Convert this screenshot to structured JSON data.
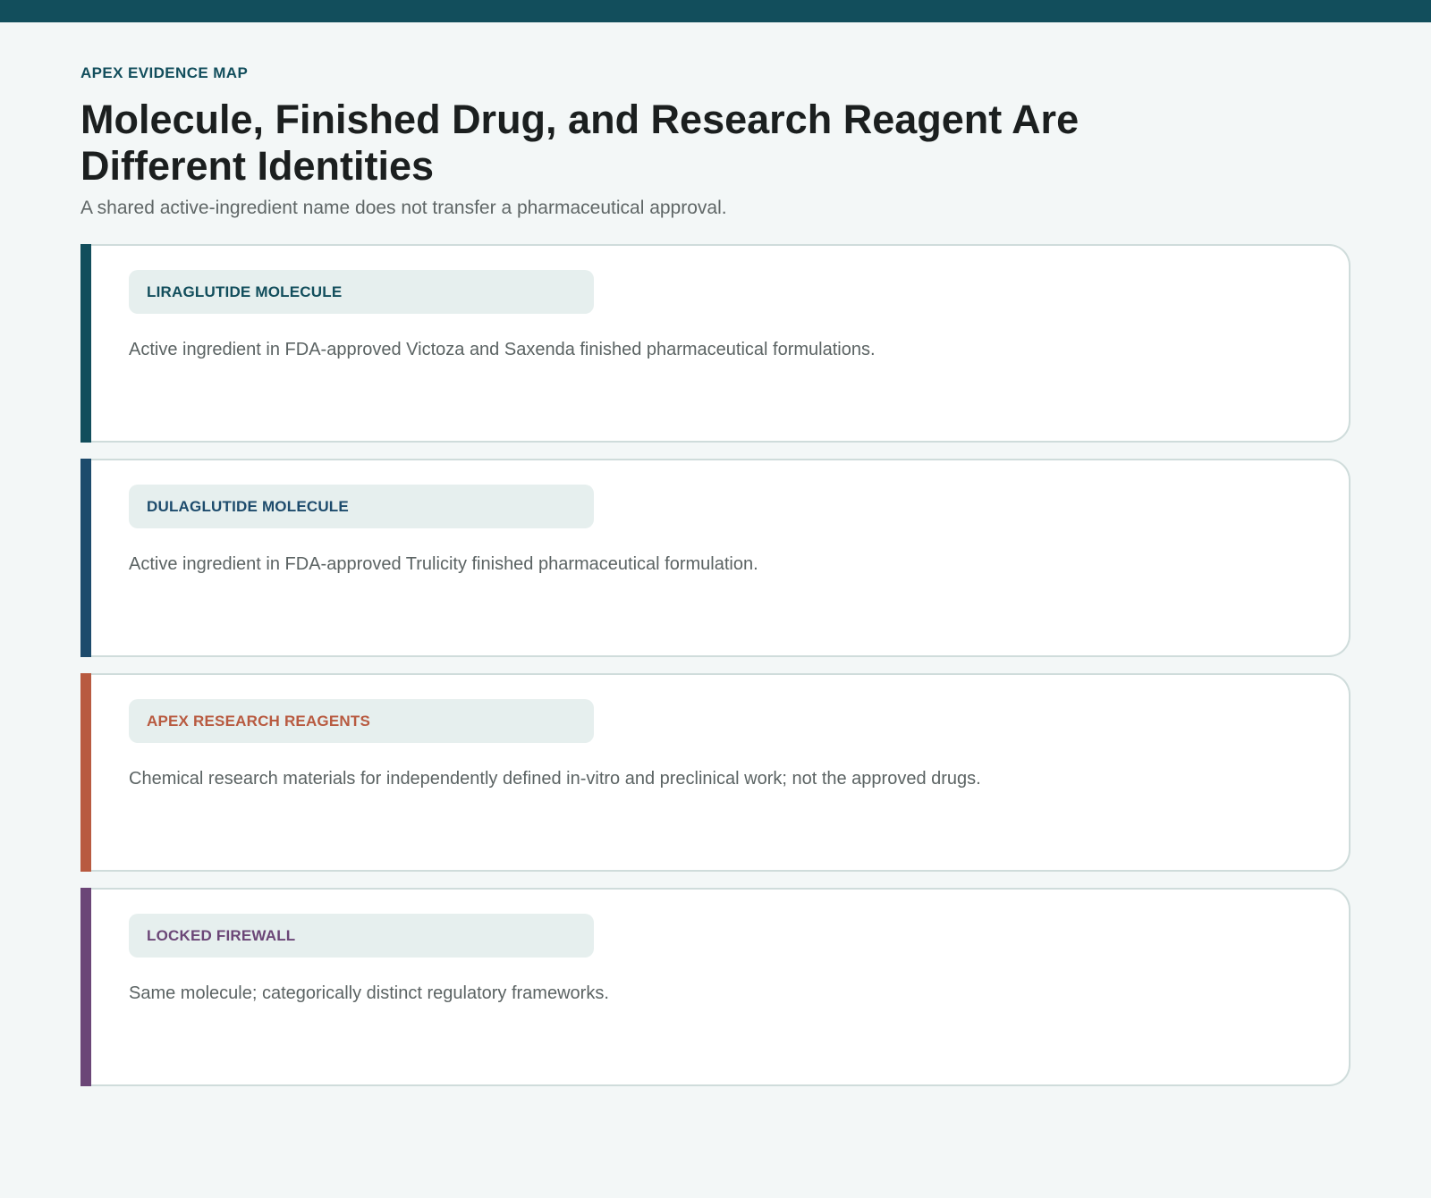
{
  "header": {
    "eyebrow": "APEX EVIDENCE MAP",
    "title": "Molecule, Finished Drug, and Research Reagent Are Different Identities",
    "subtitle": "A shared active-ingredient name does not transfer a pharmaceutical approval."
  },
  "colors": {
    "topbar": "#124e5c",
    "background": "#f3f7f7"
  },
  "cards": [
    {
      "label": "LIRAGLUTIDE MOLECULE",
      "text": "Active ingredient in FDA-approved Victoza and Saxenda finished pharmaceutical formulations.",
      "accent_color": "#124e5c"
    },
    {
      "label": "DULAGLUTIDE MOLECULE",
      "text": "Active ingredient in FDA-approved Trulicity finished pharmaceutical formulation.",
      "accent_color": "#1d4b6c"
    },
    {
      "label": "APEX RESEARCH REAGENTS",
      "text": "Chemical research materials for independently defined in-vitro and preclinical work; not the approved drugs.",
      "accent_color": "#b85a40"
    },
    {
      "label": "LOCKED FIREWALL",
      "text": "Same molecule; categorically distinct regulatory frameworks.",
      "accent_color": "#6b4677"
    }
  ]
}
